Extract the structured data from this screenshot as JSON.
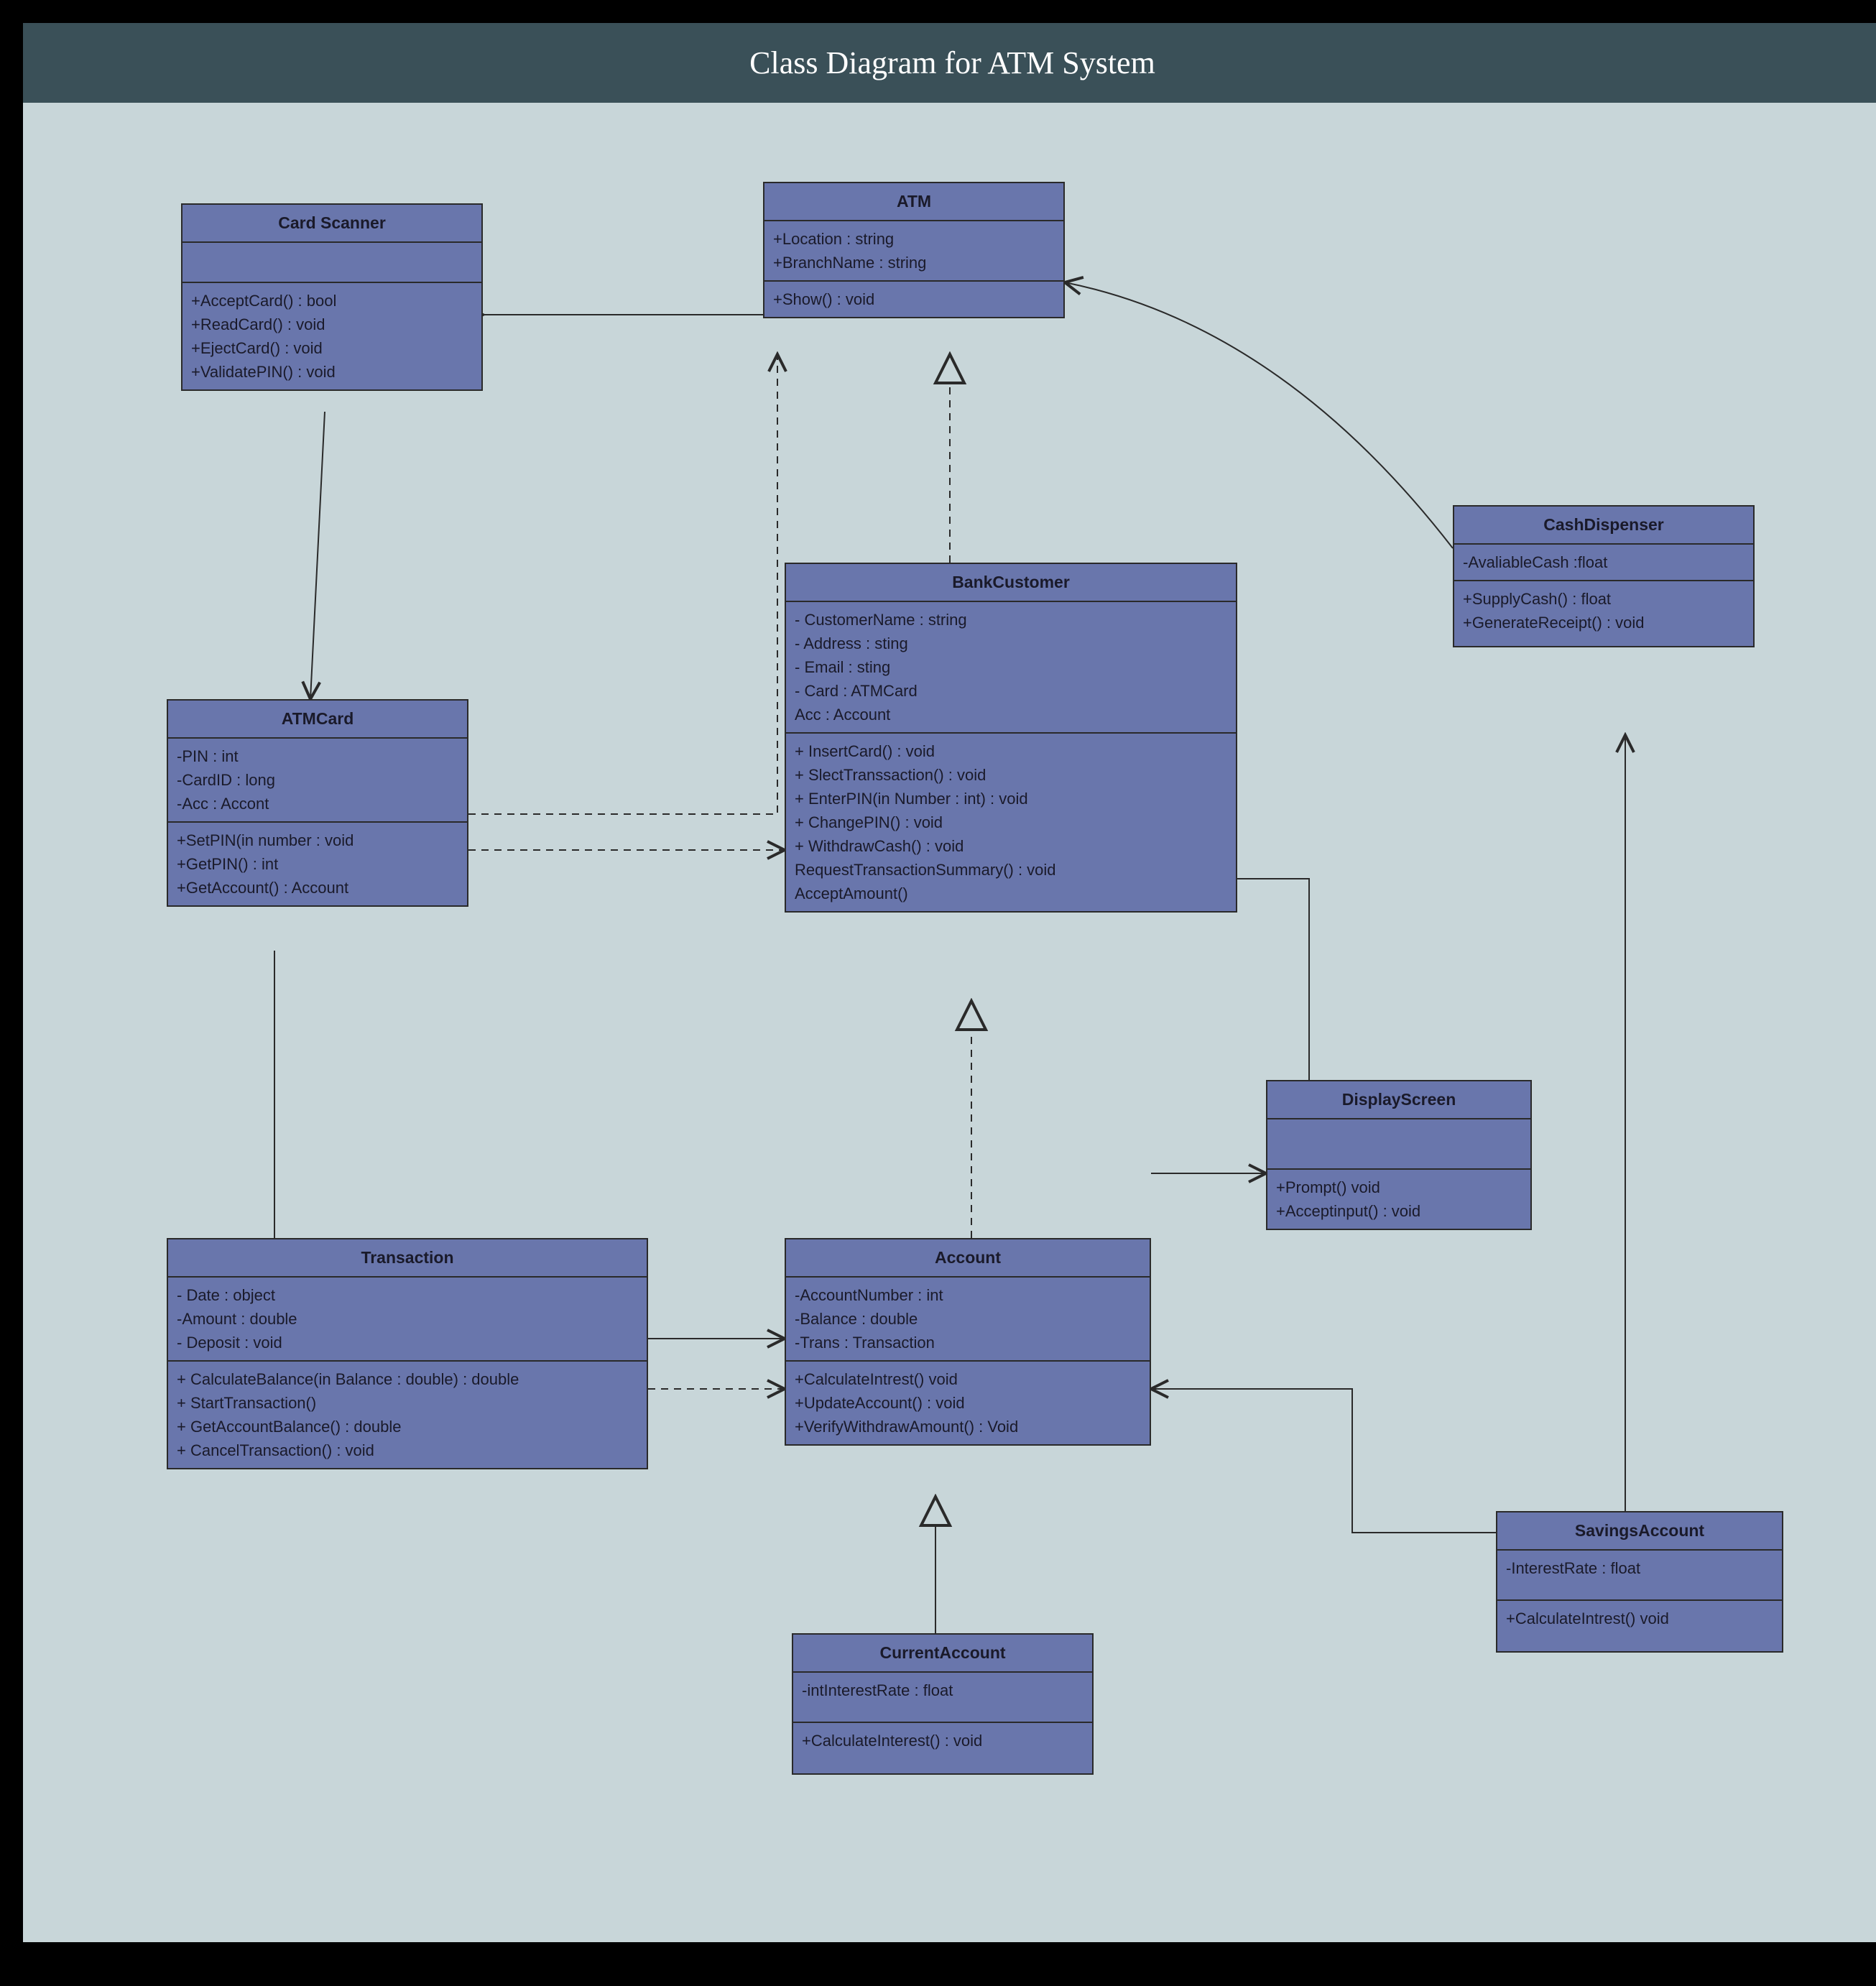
{
  "title": "Class Diagram for ATM System",
  "classes": {
    "cardScanner": {
      "name": "Card Scanner",
      "attrs": [],
      "ops": [
        "+AcceptCard() : bool",
        "+ReadCard() : void",
        "+EjectCard() : void",
        "+ValidatePIN() : void"
      ]
    },
    "atm": {
      "name": "ATM",
      "attrs": [
        "+Location : string",
        "+BranchName : string"
      ],
      "ops": [
        "+Show() : void"
      ]
    },
    "cashDispenser": {
      "name": "CashDispenser",
      "attrs": [
        "-AvaliableCash :float"
      ],
      "ops": [
        "+SupplyCash() : float",
        "+GenerateReceipt() : void"
      ]
    },
    "atmCard": {
      "name": "ATMCard",
      "attrs": [
        "-PIN : int",
        "-CardID : long",
        "-Acc : Accont"
      ],
      "ops": [
        "+SetPIN(in number : void",
        "+GetPIN() : int",
        "+GetAccount() : Account"
      ]
    },
    "bankCustomer": {
      "name": "BankCustomer",
      "attrs": [
        "- CustomerName : string",
        "- Address : sting",
        "- Email : sting",
        "- Card : ATMCard",
        "Acc : Account"
      ],
      "ops": [
        "+ InsertCard() : void",
        "+ SlectTranssaction() : void",
        "+ EnterPIN(in Number : int) : void",
        "+ ChangePIN() : void",
        "+ WithdrawCash() : void",
        "RequestTransactionSummary() : void",
        "AcceptAmount()"
      ]
    },
    "displayScreen": {
      "name": "DisplayScreen",
      "attrs": [],
      "ops": [
        "+Prompt() void",
        "+Acceptinput() : void"
      ]
    },
    "transaction": {
      "name": "Transaction",
      "attrs": [
        "- Date : object",
        "-Amount : double",
        "- Deposit : void"
      ],
      "ops": [
        "+ CalculateBalance(in Balance : double) : double",
        "+ StartTransaction()",
        "+ GetAccountBalance() : double",
        "+ CancelTransaction() : void"
      ]
    },
    "account": {
      "name": "Account",
      "attrs": [
        "-AccountNumber : int",
        "-Balance : double",
        "-Trans : Transaction"
      ],
      "ops": [
        "+CalculateIntrest() void",
        "+UpdateAccount() : void",
        "+VerifyWithdrawAmount() :  Void"
      ]
    },
    "currentAccount": {
      "name": "CurrentAccount",
      "attrs": [
        "-intInterestRate : float"
      ],
      "ops": [
        "+CalculateInterest() : void"
      ]
    },
    "savingsAccount": {
      "name": "SavingsAccount",
      "attrs": [
        "-InterestRate : float"
      ],
      "ops": [
        "+CalculateIntrest() void"
      ]
    }
  }
}
